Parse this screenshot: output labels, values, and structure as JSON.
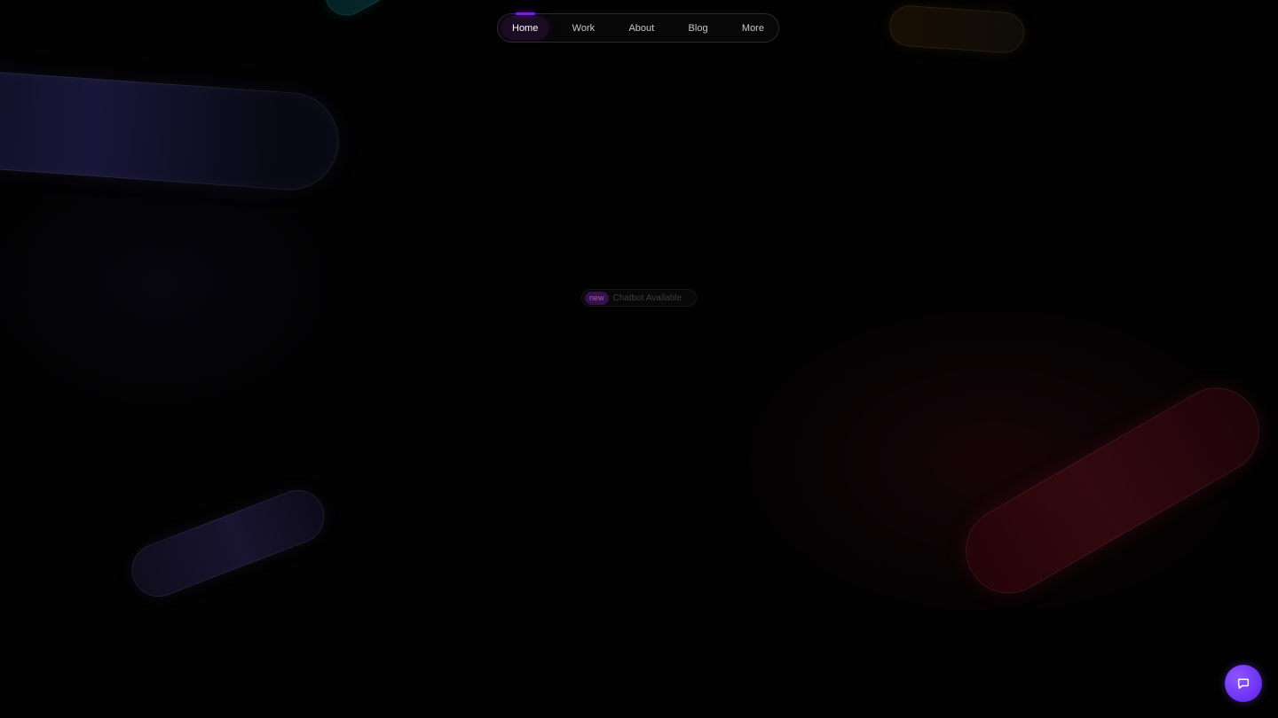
{
  "nav": {
    "items": [
      {
        "label": "Home",
        "active": true
      },
      {
        "label": "Work",
        "active": false
      },
      {
        "label": "About",
        "active": false
      },
      {
        "label": "Blog",
        "active": false
      },
      {
        "label": "More",
        "active": false
      }
    ]
  },
  "announcement": {
    "badge": "new",
    "text": "Chatbot Available"
  },
  "chat_button": {
    "icon": "chat-bubble-icon",
    "color": "#7a43ff"
  },
  "theme": {
    "background": "#020202",
    "accent": "#7f1fd2"
  }
}
